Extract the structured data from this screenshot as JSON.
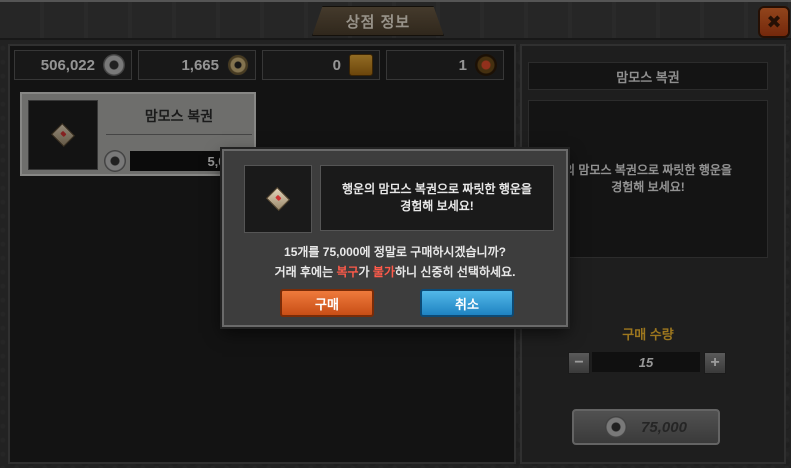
{
  "window": {
    "title": "상점 정보",
    "close_icon": "close-icon"
  },
  "currencies": [
    {
      "value": "506,022",
      "icon": "coin-icon"
    },
    {
      "value": "1,665",
      "icon": "compass-icon"
    },
    {
      "value": "0",
      "icon": "chest-icon"
    },
    {
      "value": "1",
      "icon": "gem-icon"
    }
  ],
  "shop_item": {
    "name": "맘모스 복권",
    "price": "5,000",
    "icon": "ticket-icon"
  },
  "detail": {
    "title": "맘모스 복권",
    "description_line1": "의 맘모스 복권으로 짜릿한 행운을",
    "description_line2": "경험해 보세요!",
    "qty_label": "구매 수량",
    "qty_value": "15",
    "minus": "−",
    "plus": "+",
    "total_price": "75,000"
  },
  "dialog": {
    "msg_line1": "행운의 맘모스 복권으로 짜릿한 행운을",
    "msg_line2": "경험해 보세요!",
    "question": "15개를 75,000에 정말로 구매하시겠습니까?",
    "warn_prefix": "거래 후에는 ",
    "warn_red1": "복구",
    "warn_mid": "가 ",
    "warn_red2": "불가",
    "warn_suffix": "하니 신중히 선택하세요.",
    "buy_label": "구매",
    "cancel_label": "취소"
  },
  "colors": {
    "accent_orange": "#ef7a3c",
    "accent_blue": "#52b8e8",
    "qty_label_gold": "#f1b72e",
    "warning_red": "#ff5a4a"
  }
}
